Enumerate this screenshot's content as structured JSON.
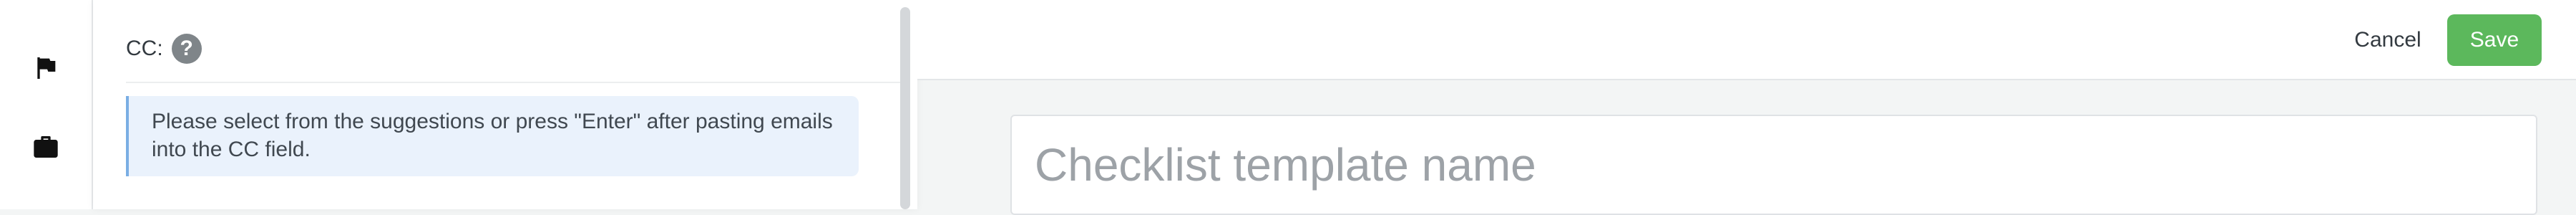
{
  "rail": {
    "icons": [
      "flag-icon",
      "briefcase-icon"
    ]
  },
  "panel": {
    "cc_label": "CC:",
    "help_glyph": "?",
    "note": "Please select from the suggestions or press \"Enter\" after pasting emails into the CC field."
  },
  "header": {
    "cancel_label": "Cancel",
    "save_label": "Save"
  },
  "main": {
    "name_placeholder": "Checklist template name",
    "name_value": ""
  },
  "colors": {
    "save": "#5cb85c",
    "note_bg": "#eaf2fc",
    "note_border": "#7aaee4",
    "background": "#f3f5f5"
  }
}
